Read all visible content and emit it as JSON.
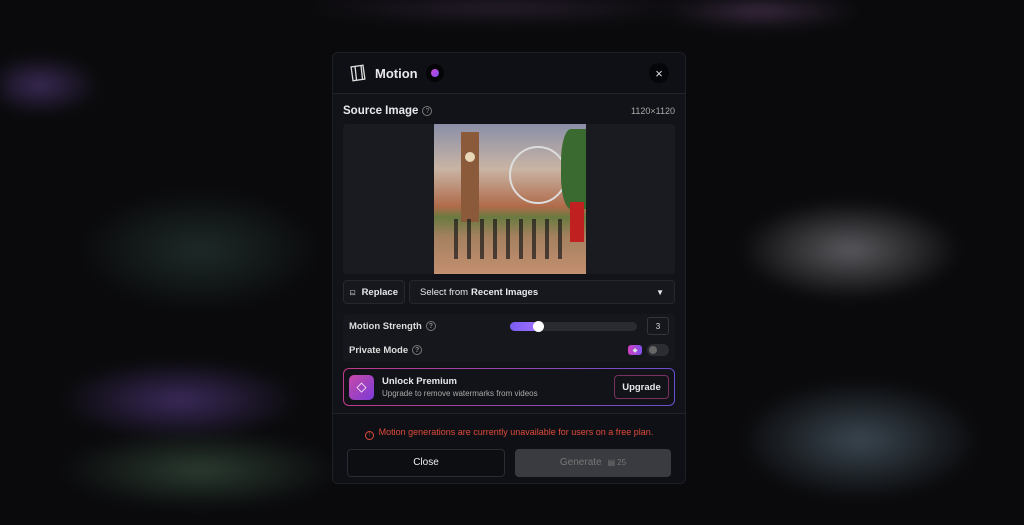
{
  "modal": {
    "title": "Motion",
    "close_icon": "×",
    "help_badge": "?"
  },
  "source": {
    "label": "Source Image",
    "help": "?",
    "dimensions": "1120×1120"
  },
  "actions": {
    "replace": "Replace",
    "select_prefix": "Select from",
    "select_bold": "Recent Images"
  },
  "settings": {
    "motion_strength_label": "Motion Strength",
    "motion_strength_value": "3",
    "motion_strength_fraction": 0.22,
    "private_mode_label": "Private Mode",
    "private_mode_on": false
  },
  "premium": {
    "title": "Unlock Premium",
    "subtitle": "Upgrade to remove watermarks from videos",
    "button": "Upgrade"
  },
  "footer": {
    "error": "Motion generations are currently unavailable for users on a free plan.",
    "close": "Close",
    "generate": "Generate",
    "cost": "25"
  },
  "colors": {
    "accent": "#8a5cf6",
    "error": "#e04a3a",
    "premium_gradient": [
      "#c84aa8",
      "#7a3ad8"
    ]
  }
}
